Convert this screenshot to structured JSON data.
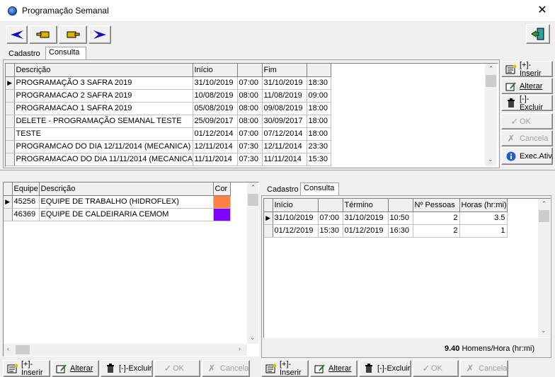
{
  "window": {
    "title": "Programação Semanal",
    "close_glyph": "✕"
  },
  "toolbar": {
    "nav_buttons": [
      {
        "icon": "first-arrow-icon",
        "color": "#1010c0"
      },
      {
        "icon": "prev-hand-icon",
        "color": "#d0a000"
      },
      {
        "icon": "next-hand-icon",
        "color": "#d0a000"
      },
      {
        "icon": "last-arrow-icon",
        "color": "#1010c0"
      }
    ],
    "exit_icon": "exit-door-icon"
  },
  "top_tabs": {
    "cadastro": "Cadastro",
    "consulta": "Consulta"
  },
  "programs": {
    "columns": [
      "Descrição",
      "Início",
      "",
      "Fim",
      ""
    ],
    "rows": [
      [
        "PROGRAMAÇÃO 3 SAFRA 2019",
        "31/10/2019",
        "07:00",
        "31/10/2019",
        "18:30"
      ],
      [
        "PROGRAMACAO 2 SAFRA 2019",
        "10/08/2019",
        "08:00",
        "11/08/2019",
        "09:00"
      ],
      [
        "PROGRAMACAO 1 SAFRA 2019",
        "05/08/2019",
        "08:00",
        "09/08/2019",
        "18:00"
      ],
      [
        "DELETE - PROGRAMAÇÃO SEMANAL TESTE",
        "25/09/2017",
        "08:00",
        "30/09/2017",
        "18:00"
      ],
      [
        "TESTE",
        "01/12/2014",
        "07:00",
        "07/12/2014",
        "18:00"
      ],
      [
        "PROGRAMCAO DO DIA 12/11/2014 (MECANICA)",
        "12/11/2014",
        "07:30",
        "12/11/2014",
        "23:30"
      ],
      [
        "PROGRAMACAO DO DIA 11/11/2014 (MECANICA)",
        "11/11/2014",
        "07:30",
        "11/11/2014",
        "15:30"
      ]
    ]
  },
  "side_actions": {
    "inserir": "[+]-Inserir",
    "alterar": "Alterar",
    "excluir": "[-]-Excluir",
    "ok": "OK",
    "cancela": "Cancela",
    "exec": "Exec.Ativ."
  },
  "teams": {
    "columns": [
      "Equipe",
      "Descrição",
      "Cor"
    ],
    "rows": [
      {
        "id": "45256",
        "desc": "EQUIPE DE TRABALHO (HIDROFLEX)",
        "color": "#ff8040"
      },
      {
        "id": "46369",
        "desc": "EQUIPE DE CALDEIRARIA CEMOM",
        "color": "#8000ff"
      }
    ]
  },
  "right_tabs": {
    "cadastro": "Cadastro",
    "consulta": "Consulta"
  },
  "schedule": {
    "columns": [
      "Início",
      "",
      "Término",
      "",
      "Nº Pessoas",
      "Horas (hr:mi)"
    ],
    "rows": [
      [
        "31/10/2019",
        "07:00",
        "31/10/2019",
        "10:50",
        "2",
        "3.5"
      ],
      [
        "01/12/2019",
        "15:30",
        "01/12/2019",
        "16:30",
        "2",
        "1"
      ]
    ]
  },
  "summary": {
    "total": "9.40",
    "unit": "Homens/Hora (hr:mi)"
  },
  "bottom_actions": {
    "inserir": "[+]-Inserir",
    "alterar": "Alterar",
    "excluir": "[-]-Excluir",
    "ok": "OK",
    "cancela": "Cancela"
  }
}
